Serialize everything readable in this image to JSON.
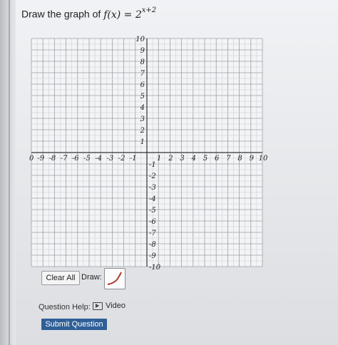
{
  "question": {
    "prompt_text": "Draw the graph of",
    "function_expr": "f(x) = 2",
    "exponent": "x+2"
  },
  "graph": {
    "x_ticks": [
      "10",
      "-9",
      "-8",
      "-7",
      "-6",
      "-5",
      "-4",
      "-3",
      "-2",
      "-1",
      "1",
      "2",
      "3",
      "4",
      "5",
      "6",
      "7",
      "8",
      "9",
      "10"
    ],
    "y_ticks_positive": [
      "10",
      "9",
      "8",
      "7",
      "6",
      "5",
      "4",
      "3",
      "2",
      "1"
    ],
    "y_ticks_negative": [
      "-1",
      "-2",
      "-3",
      "-4",
      "-5",
      "-6",
      "-7",
      "-8",
      "-9",
      "-10"
    ],
    "x_range": [
      -10,
      10
    ],
    "y_range": [
      -10,
      10
    ]
  },
  "toolbar": {
    "clear_all_label": "Clear All",
    "draw_label": "Draw:",
    "draw_tool_icon": "curve-draw-icon"
  },
  "help": {
    "label": "Question Help:",
    "video_label": "Video",
    "video_icon": "video-play-icon"
  },
  "submit": {
    "label": "Submit Question"
  },
  "colors": {
    "submit_bg": "#2f5f96",
    "curve_icon": "#b03a2e",
    "grid": "#9aa0a6"
  }
}
